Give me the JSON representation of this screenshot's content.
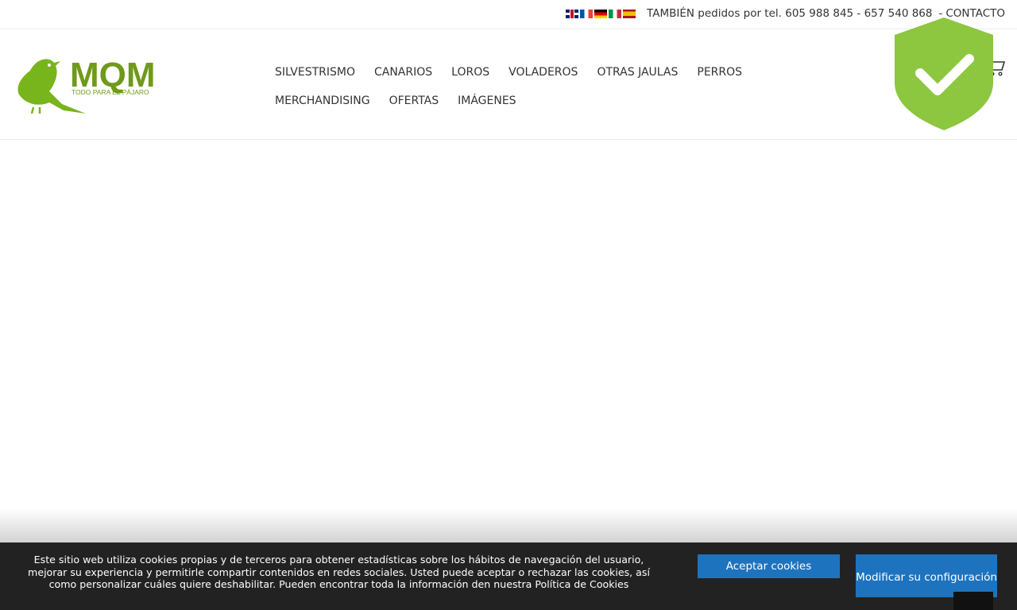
{
  "topbar": {
    "languages": [
      "English",
      "Français",
      "Deutsch",
      "Italiano",
      "Español"
    ],
    "phone_text": "TAMBIÉN pedidos por tel. 605 988 845 - 657 540 868",
    "separator": "-",
    "contact_label": "CONTACTO"
  },
  "logo": {
    "title": "MQM",
    "subtitle": "TODO PARA EL PÁJARO"
  },
  "nav": {
    "row1": [
      "SILVESTRISMO",
      "CANARIOS",
      "LOROS",
      "VOLADEROS",
      "OTRAS JAULAS",
      "PERROS"
    ],
    "row2": [
      "MERCHANDISING",
      "OFERTAS",
      "IMÁGENES"
    ]
  },
  "cookie": {
    "message": "Este sitio web utiliza cookies propias y de terceros para obtener estadísticas sobre los hábitos de navegación del usuario, mejorar su experiencia y permitirle compartir contenidos en redes sociales. Usted puede aceptar o rechazar las cookies, así como personalizar cuáles quiere deshabilitar. Pueden encontrar toda la información den nuestra Política de Cookies",
    "accept_label": "Aceptar cookies",
    "config_label": "Modificar su configuración"
  },
  "colors": {
    "brand_green": "#6f9a1a",
    "shield_green": "#8dc63f",
    "button_blue": "#1e73be",
    "cookie_bg": "#222222"
  },
  "icons": {
    "cart": "cart-icon",
    "shield": "shield-check-icon"
  }
}
